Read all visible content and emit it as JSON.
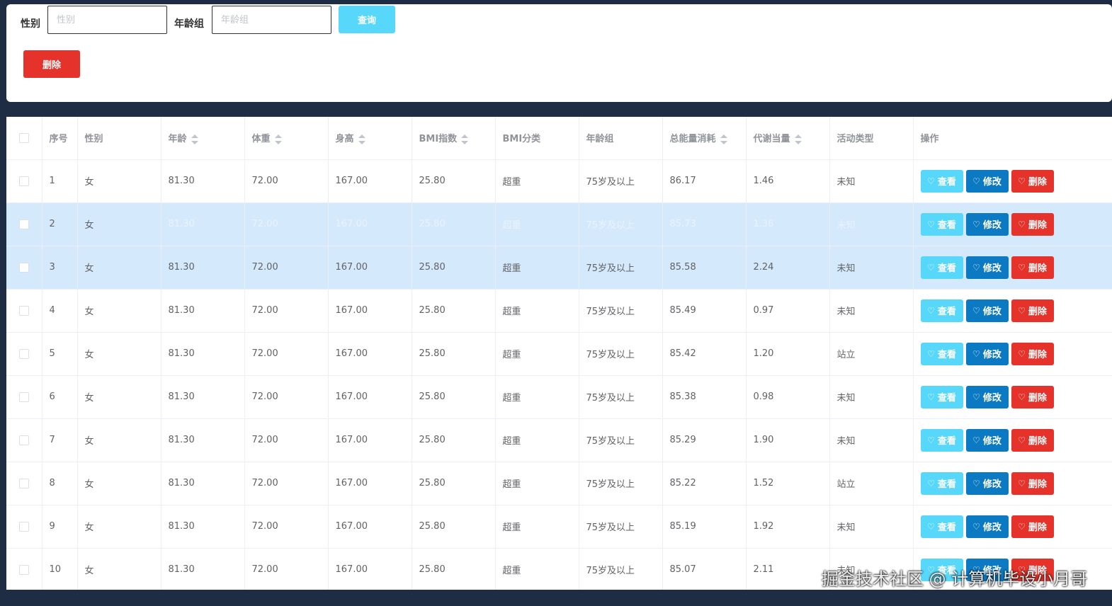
{
  "filters": {
    "gender_label": "性别",
    "gender_placeholder": "性别",
    "age_group_label": "年龄组",
    "age_group_placeholder": "年龄组",
    "search_label": "查询",
    "delete_label": "删除"
  },
  "table": {
    "headers": [
      "序号",
      "性别",
      "年龄",
      "体重",
      "身高",
      "BMI指数",
      "BMI分类",
      "年龄组",
      "总能量消耗",
      "代谢当量",
      "活动类型",
      "操作"
    ],
    "rows": [
      {
        "index": "1",
        "gender": "女",
        "age": "81.30",
        "weight": "72.00",
        "height": "167.00",
        "bmi": "25.80",
        "bmi_class": "超重",
        "age_group": "75岁及以上",
        "energy": "86.17",
        "met": "1.46",
        "activity": "未知"
      },
      {
        "index": "2",
        "gender": "女",
        "age": "81.30",
        "weight": "72.00",
        "height": "167.00",
        "bmi": "25.80",
        "bmi_class": "超重",
        "age_group": "75岁及以上",
        "energy": "85.73",
        "met": "1.36",
        "activity": "未知"
      },
      {
        "index": "3",
        "gender": "女",
        "age": "81.30",
        "weight": "72.00",
        "height": "167.00",
        "bmi": "25.80",
        "bmi_class": "超重",
        "age_group": "75岁及以上",
        "energy": "85.58",
        "met": "2.24",
        "activity": "未知"
      },
      {
        "index": "4",
        "gender": "女",
        "age": "81.30",
        "weight": "72.00",
        "height": "167.00",
        "bmi": "25.80",
        "bmi_class": "超重",
        "age_group": "75岁及以上",
        "energy": "85.49",
        "met": "0.97",
        "activity": "未知"
      },
      {
        "index": "5",
        "gender": "女",
        "age": "81.30",
        "weight": "72.00",
        "height": "167.00",
        "bmi": "25.80",
        "bmi_class": "超重",
        "age_group": "75岁及以上",
        "energy": "85.42",
        "met": "1.20",
        "activity": "站立"
      },
      {
        "index": "6",
        "gender": "女",
        "age": "81.30",
        "weight": "72.00",
        "height": "167.00",
        "bmi": "25.80",
        "bmi_class": "超重",
        "age_group": "75岁及以上",
        "energy": "85.38",
        "met": "0.98",
        "activity": "未知"
      },
      {
        "index": "7",
        "gender": "女",
        "age": "81.30",
        "weight": "72.00",
        "height": "167.00",
        "bmi": "25.80",
        "bmi_class": "超重",
        "age_group": "75岁及以上",
        "energy": "85.29",
        "met": "1.90",
        "activity": "未知"
      },
      {
        "index": "8",
        "gender": "女",
        "age": "81.30",
        "weight": "72.00",
        "height": "167.00",
        "bmi": "25.80",
        "bmi_class": "超重",
        "age_group": "75岁及以上",
        "energy": "85.22",
        "met": "1.52",
        "activity": "站立"
      },
      {
        "index": "9",
        "gender": "女",
        "age": "81.30",
        "weight": "72.00",
        "height": "167.00",
        "bmi": "25.80",
        "bmi_class": "超重",
        "age_group": "75岁及以上",
        "energy": "85.19",
        "met": "1.92",
        "activity": "未知"
      },
      {
        "index": "10",
        "gender": "女",
        "age": "81.30",
        "weight": "72.00",
        "height": "167.00",
        "bmi": "25.80",
        "bmi_class": "超重",
        "age_group": "75岁及以上",
        "energy": "85.07",
        "met": "2.11",
        "activity": "未知"
      }
    ],
    "actions": {
      "view": "查看",
      "edit": "修改",
      "delete": "删除"
    }
  },
  "watermark": "掘金技术社区 @ 计算机毕设小月哥",
  "colors": {
    "view": "#57d8fb",
    "edit": "#0b7ac2",
    "delete": "#e5322a",
    "selected_row": "#d5e9fc"
  },
  "icons": {
    "action_icon": "heart-icon",
    "sort_icon": "sort-caret-icon"
  }
}
